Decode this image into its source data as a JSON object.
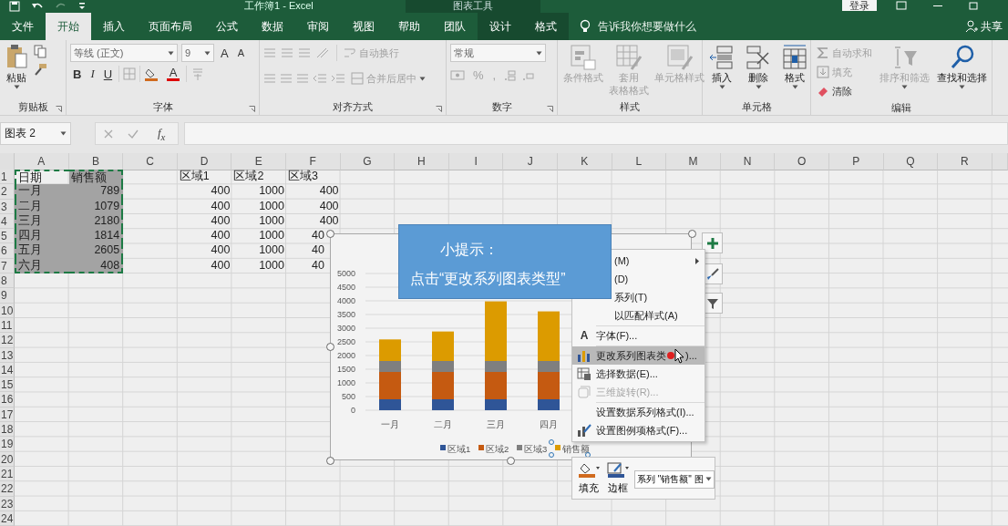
{
  "title_bar": {
    "title": "工作簿1 - Excel",
    "context_label": "图表工具",
    "sign_in": "登录"
  },
  "tabs": [
    {
      "label": "文件",
      "selected": false,
      "contextual": false
    },
    {
      "label": "开始",
      "selected": true,
      "contextual": false
    },
    {
      "label": "插入",
      "selected": false,
      "contextual": false
    },
    {
      "label": "页面布局",
      "selected": false,
      "contextual": false
    },
    {
      "label": "公式",
      "selected": false,
      "contextual": false
    },
    {
      "label": "数据",
      "selected": false,
      "contextual": false
    },
    {
      "label": "审阅",
      "selected": false,
      "contextual": false
    },
    {
      "label": "视图",
      "selected": false,
      "contextual": false
    },
    {
      "label": "帮助",
      "selected": false,
      "contextual": false
    },
    {
      "label": "团队",
      "selected": false,
      "contextual": false
    },
    {
      "label": "设计",
      "selected": false,
      "contextual": true
    },
    {
      "label": "格式",
      "selected": false,
      "contextual": true
    }
  ],
  "tell_me": "告诉我你想要做什么",
  "share": "共享",
  "ribbon": {
    "clipboard": {
      "label": "剪贴板",
      "paste": "粘贴"
    },
    "font": {
      "label": "字体",
      "name": "等线 (正文)",
      "size": "9",
      "grow": "A",
      "shrink": "A",
      "bold": "B",
      "italic": "I",
      "underline": "U",
      "font_color_letter": "A"
    },
    "alignment": {
      "label": "对齐方式",
      "wrap": "自动换行",
      "merge": "合并后居中"
    },
    "number": {
      "label": "数字",
      "format": "常规",
      "percent": "%",
      "comma": ","
    },
    "styles": {
      "label": "样式",
      "items": [
        {
          "lines": [
            "条件格式"
          ],
          "disabled": true
        },
        {
          "lines": [
            "套用",
            "表格格式"
          ],
          "disabled": true
        },
        {
          "lines": [
            "单元格样式"
          ],
          "disabled": true
        }
      ]
    },
    "cells": {
      "label": "单元格",
      "items": [
        {
          "lines": [
            "插入"
          ],
          "disabled": false
        },
        {
          "lines": [
            "删除"
          ],
          "disabled": false
        },
        {
          "lines": [
            "格式"
          ],
          "disabled": false
        }
      ]
    },
    "editing": {
      "label": "编辑",
      "small": [
        {
          "label": "自动求和",
          "disabled": true
        },
        {
          "label": "填充",
          "disabled": true
        },
        {
          "label": "清除",
          "disabled": false
        }
      ],
      "big": [
        {
          "label": "排序和筛选",
          "disabled": true
        },
        {
          "label": "查找和选择",
          "disabled": false
        }
      ]
    }
  },
  "formula_bar": {
    "name_box": "图表 2",
    "fx": "f$_{x}$"
  },
  "sheet": {
    "columns": [
      "A",
      "B",
      "C",
      "D",
      "E",
      "F",
      "G",
      "H",
      "I",
      "J",
      "K",
      "L",
      "M",
      "N",
      "O",
      "P",
      "Q",
      "R"
    ],
    "rows": [
      {
        "number": "1",
        "cells": [
          {
            "text": "日期",
            "shaded": false,
            "marquee": true
          },
          {
            "text": "销售额",
            "shaded": true,
            "marquee": true
          },
          null,
          {
            "text": "区域1",
            "shaded": false,
            "marquee": false
          },
          {
            "text": "区域2",
            "shaded": false,
            "marquee": false
          },
          {
            "text": "区域3",
            "shaded": false,
            "marquee": false
          }
        ]
      },
      {
        "number": "2",
        "cells": [
          {
            "text": "一月",
            "shaded": true,
            "marquee": true
          },
          {
            "text": "789",
            "shaded": true,
            "marquee": true,
            "numeric": true
          },
          null,
          {
            "text": "400",
            "shaded": false,
            "marquee": false,
            "numeric": true
          },
          {
            "text": "1000",
            "shaded": false,
            "marquee": false,
            "numeric": true
          },
          {
            "text": "400",
            "shaded": false,
            "marquee": false,
            "numeric": true
          }
        ]
      },
      {
        "number": "3",
        "cells": [
          {
            "text": "二月",
            "shaded": true,
            "marquee": true
          },
          {
            "text": "1079",
            "shaded": true,
            "marquee": true,
            "numeric": true
          },
          null,
          {
            "text": "400",
            "shaded": false,
            "marquee": false,
            "numeric": true
          },
          {
            "text": "1000",
            "shaded": false,
            "marquee": false,
            "numeric": true
          },
          {
            "text": "400",
            "shaded": false,
            "marquee": false,
            "numeric": true
          }
        ]
      },
      {
        "number": "4",
        "cells": [
          {
            "text": "三月",
            "shaded": true,
            "marquee": true
          },
          {
            "text": "2180",
            "shaded": true,
            "marquee": true,
            "numeric": true
          },
          null,
          {
            "text": "400",
            "shaded": false,
            "marquee": false,
            "numeric": true
          },
          {
            "text": "1000",
            "shaded": false,
            "marquee": false,
            "numeric": true
          },
          {
            "text": "400",
            "shaded": false,
            "marquee": false,
            "numeric": true
          }
        ]
      },
      {
        "number": "5",
        "cells": [
          {
            "text": "四月",
            "shaded": true,
            "marquee": true
          },
          {
            "text": "1814",
            "shaded": true,
            "marquee": true,
            "numeric": true
          },
          null,
          {
            "text": "400",
            "shaded": false,
            "marquee": false,
            "numeric": true
          },
          {
            "text": "1000",
            "shaded": false,
            "marquee": false,
            "numeric": true
          },
          {
            "text": "40",
            "shaded": false,
            "marquee": false,
            "numeric": true,
            "clipped": true
          }
        ]
      },
      {
        "number": "6",
        "cells": [
          {
            "text": "五月",
            "shaded": true,
            "marquee": true
          },
          {
            "text": "2605",
            "shaded": true,
            "marquee": true,
            "numeric": true
          },
          null,
          {
            "text": "400",
            "shaded": false,
            "marquee": false,
            "numeric": true
          },
          {
            "text": "1000",
            "shaded": false,
            "marquee": false,
            "numeric": true
          },
          {
            "text": "40",
            "shaded": false,
            "marquee": false,
            "numeric": true,
            "clipped": true
          }
        ]
      },
      {
        "number": "7",
        "cells": [
          {
            "text": "六月",
            "shaded": true,
            "marquee": true
          },
          {
            "text": "408",
            "shaded": true,
            "marquee": true,
            "numeric": true
          },
          null,
          {
            "text": "400",
            "shaded": false,
            "marquee": false,
            "numeric": true
          },
          {
            "text": "1000",
            "shaded": false,
            "marquee": false,
            "numeric": true
          },
          {
            "text": "40",
            "shaded": false,
            "marquee": false,
            "numeric": true,
            "clipped": true
          }
        ]
      },
      {
        "number": "8"
      },
      {
        "number": "9"
      },
      {
        "number": "10"
      },
      {
        "number": "11"
      },
      {
        "number": "12"
      },
      {
        "number": "13"
      },
      {
        "number": "14"
      },
      {
        "number": "15"
      },
      {
        "number": "16"
      },
      {
        "number": "17"
      },
      {
        "number": "18"
      },
      {
        "number": "19"
      },
      {
        "number": "20"
      },
      {
        "number": "21"
      },
      {
        "number": "22"
      },
      {
        "number": "23"
      },
      {
        "number": "24"
      }
    ]
  },
  "chart": {
    "chart_data": {
      "type": "bar",
      "orientation": "vertical",
      "stacked": true,
      "grid": true,
      "legend": "bottom",
      "categories": [
        "一月",
        "二月",
        "三月",
        "四月"
      ],
      "series": [
        {
          "name": "区域1",
          "color": "#2f5597",
          "values": [
            400,
            400,
            400,
            400
          ]
        },
        {
          "name": "区域2",
          "color": "#c55a11",
          "values": [
            1000,
            1000,
            1000,
            1000
          ]
        },
        {
          "name": "区域3",
          "color": "#7f7f7f",
          "values": [
            400,
            400,
            400,
            400
          ]
        },
        {
          "name": "销售额",
          "color": "#dc9b00",
          "values": [
            789,
            1079,
            2180,
            1814
          ]
        }
      ],
      "ylim": [
        0,
        5000
      ],
      "yticks": [
        0,
        500,
        1000,
        1500,
        2000,
        2500,
        3000,
        3500,
        4000,
        4500,
        5000
      ]
    }
  },
  "callout": {
    "title": "小提示：",
    "text": "点击“更改系列图表类型”"
  },
  "context_menu": [
    {
      "label": "(M)",
      "partial": true,
      "submenu": true,
      "selected": false,
      "disabled": false
    },
    {
      "label": "(D)",
      "partial": true,
      "submenu": false,
      "selected": false,
      "disabled": false
    },
    {
      "label": "系列(T)",
      "partial": true,
      "submenu": false,
      "selected": false,
      "disabled": false
    },
    {
      "label": "以匹配样式(A)",
      "partial": true,
      "submenu": false,
      "selected": false,
      "disabled": false,
      "separator_after": true
    },
    {
      "label": "字体(F)...",
      "glyph": "A",
      "partial": false,
      "submenu": false,
      "selected": false,
      "disabled": false,
      "separator_after": true
    },
    {
      "label": "更改系列图表类",
      "label_after": ")...",
      "pointer": true,
      "partial": false,
      "submenu": false,
      "selected": true,
      "disabled": false
    },
    {
      "label": "选择数据(E)...",
      "partial": false,
      "submenu": false,
      "selected": false,
      "disabled": false
    },
    {
      "label": "三维旋转(R)...",
      "partial": false,
      "submenu": false,
      "selected": false,
      "disabled": true,
      "separator_after": true
    },
    {
      "label": "设置数据系列格式(I)...",
      "partial": false,
      "submenu": false,
      "selected": false,
      "disabled": false
    },
    {
      "label": "设置图例项格式(F)...",
      "partial": false,
      "submenu": false,
      "selected": false,
      "disabled": false
    }
  ],
  "mini_toolbar": {
    "fill": "填充",
    "border": "边框",
    "series_picker": "系列 \"销售额\" 图"
  }
}
